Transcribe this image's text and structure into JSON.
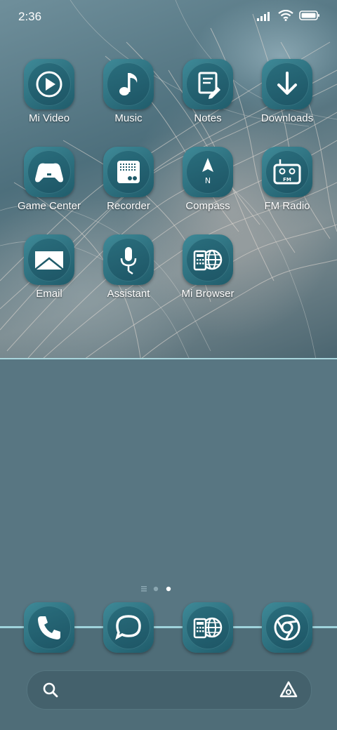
{
  "status_bar": {
    "time": "2:36"
  },
  "apps": [
    {
      "label": "Mi Video",
      "icon": "play-icon"
    },
    {
      "label": "Music",
      "icon": "music-note-icon"
    },
    {
      "label": "Notes",
      "icon": "notes-icon"
    },
    {
      "label": "Downloads",
      "icon": "download-icon"
    },
    {
      "label": "Game Center",
      "icon": "gamepad-icon"
    },
    {
      "label": "Recorder",
      "icon": "recorder-icon"
    },
    {
      "label": "Compass",
      "icon": "compass-icon"
    },
    {
      "label": "FM Radio",
      "icon": "radio-icon"
    },
    {
      "label": "Email",
      "icon": "envelope-icon"
    },
    {
      "label": "Assistant",
      "icon": "microphone-icon"
    },
    {
      "label": "Mi Browser",
      "icon": "browser-icon"
    }
  ],
  "dock": [
    {
      "name": "phone",
      "icon": "phone-icon"
    },
    {
      "name": "messages",
      "icon": "chat-bubble-icon"
    },
    {
      "name": "browser",
      "icon": "browser-icon"
    },
    {
      "name": "chrome",
      "icon": "chrome-icon"
    }
  ],
  "page_indicator": {
    "pages": 2,
    "current": 2
  },
  "colors": {
    "tile": "#2a6e7d",
    "accent_line": "#a9d6dd",
    "background": "#577784"
  }
}
